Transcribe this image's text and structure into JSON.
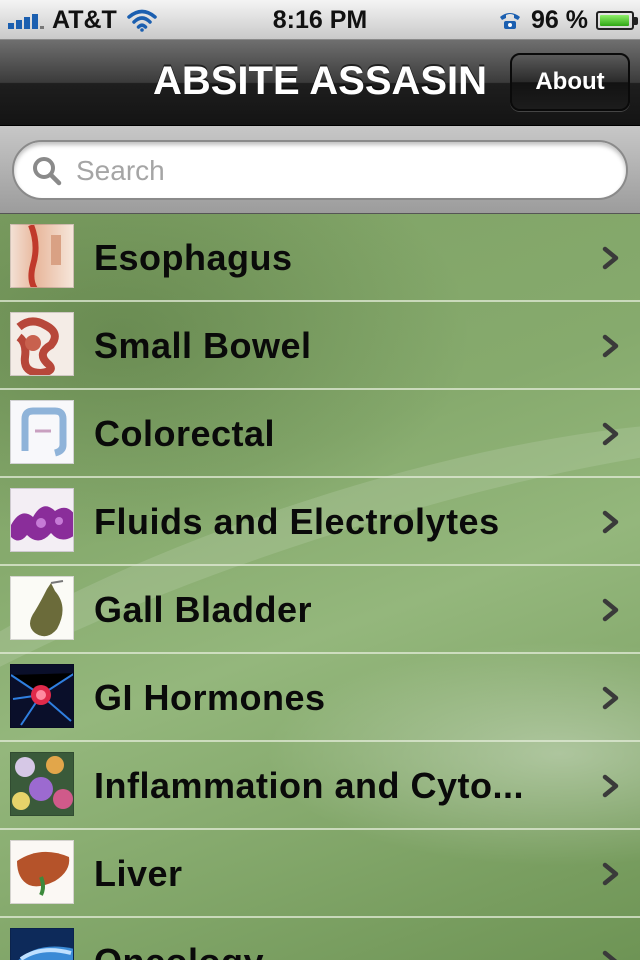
{
  "status_bar": {
    "carrier": "AT&T",
    "time": "8:16 PM",
    "battery_percent": "96 %",
    "battery_level": 0.96,
    "signal_bars": 4,
    "icons": [
      "signal-icon",
      "wifi-icon",
      "phone-icon",
      "battery-icon"
    ]
  },
  "nav": {
    "title": "ABSITE ASSASIN",
    "about_label": "About"
  },
  "search": {
    "placeholder": "Search"
  },
  "topics": [
    {
      "label": "Esophagus"
    },
    {
      "label": "Small Bowel"
    },
    {
      "label": "Colorectal"
    },
    {
      "label": "Fluids and Electrolytes"
    },
    {
      "label": "Gall Bladder"
    },
    {
      "label": "GI Hormones"
    },
    {
      "label": "Inflammation and Cyto..."
    },
    {
      "label": "Liver"
    },
    {
      "label": "Oncology"
    }
  ],
  "colors": {
    "list_green": "#86aa6d",
    "nav_dark": "#1e1e1e",
    "signal_blue": "#1b5fb0",
    "battery_green": "#2fa614"
  }
}
